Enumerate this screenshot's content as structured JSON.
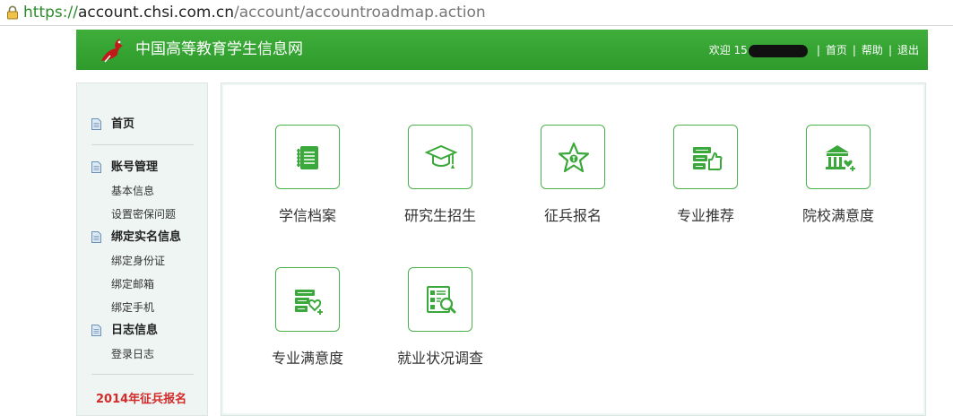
{
  "browser": {
    "url_scheme": "https://",
    "url_host": "account.chsi.com.cn",
    "url_path": "/account/accountroadmap.action"
  },
  "header": {
    "site_name": "中国高等教育学生信息网",
    "welcome": "欢迎 15",
    "nav": [
      "首页",
      "帮助",
      "退出"
    ],
    "separator": "|"
  },
  "sidebar": {
    "home": "首页",
    "groups": [
      {
        "title": "账号管理",
        "items": [
          "基本信息",
          "设置密保问题"
        ]
      },
      {
        "title": "绑定实名信息",
        "items": [
          "绑定身份证",
          "绑定邮箱",
          "绑定手机"
        ]
      },
      {
        "title": "日志信息",
        "items": [
          "登录日志"
        ]
      }
    ],
    "promo": "2014年征兵报名"
  },
  "tiles": [
    {
      "label": "学信档案",
      "icon": "file-archive-icon"
    },
    {
      "label": "研究生招生",
      "icon": "graduation-cap-icon"
    },
    {
      "label": "征兵报名",
      "icon": "army-star-icon"
    },
    {
      "label": "专业推荐",
      "icon": "thumbs-up-books-icon"
    },
    {
      "label": "院校满意度",
      "icon": "school-heart-icon"
    },
    {
      "label": "专业满意度",
      "icon": "books-heart-icon"
    },
    {
      "label": "就业状况调查",
      "icon": "survey-search-icon"
    }
  ],
  "colors": {
    "brand_green": "#34a532",
    "icon_green": "#4cb34a",
    "promo_red": "#d32a2a",
    "sidebar_bg": "#eef5f3"
  }
}
